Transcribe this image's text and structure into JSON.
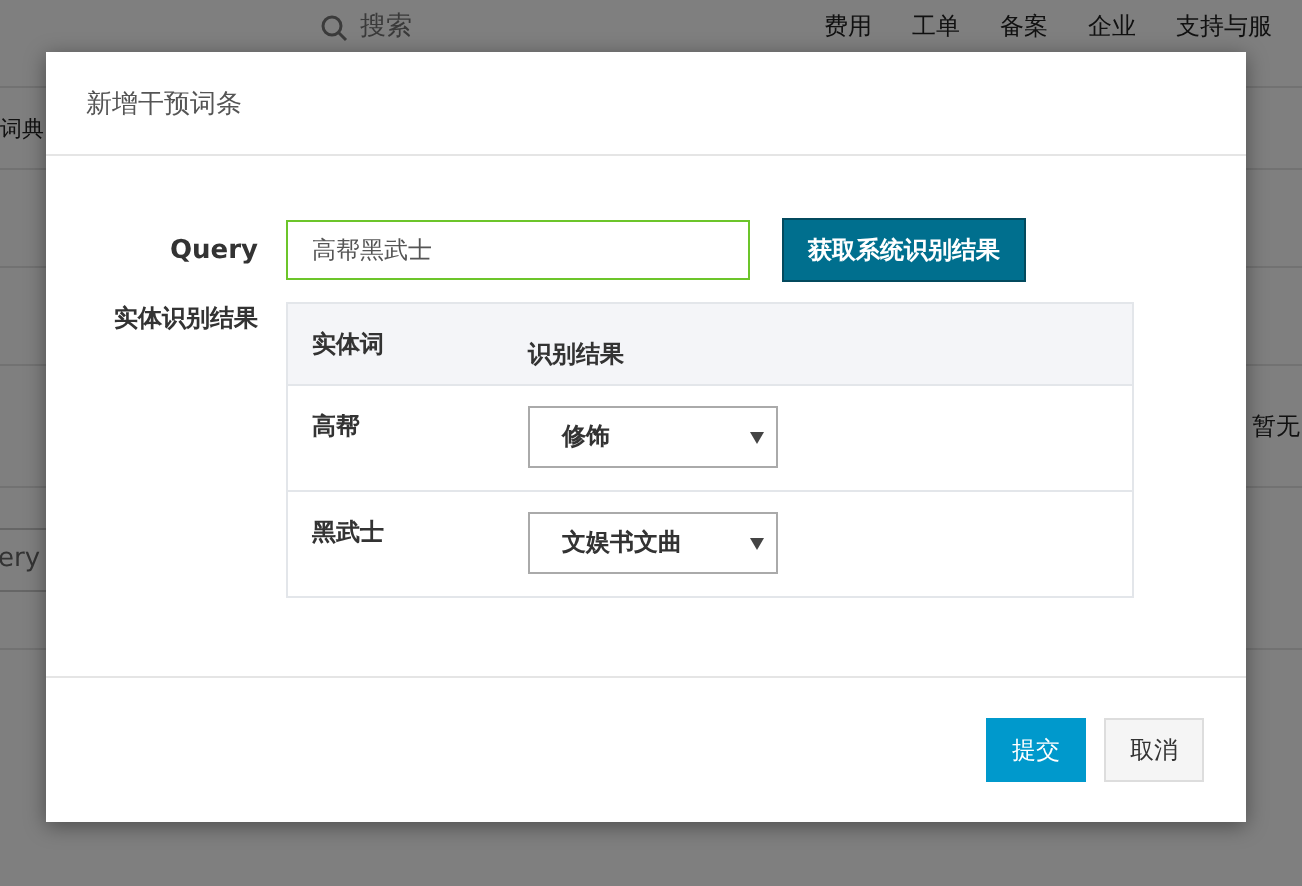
{
  "background": {
    "search": {
      "placeholder": "搜索"
    },
    "nav": [
      "费用",
      "工单",
      "备案",
      "企业",
      "支持与服"
    ],
    "list_label": "词典",
    "empty_text": "暂无",
    "field_value": "ery"
  },
  "dialog": {
    "title": "新增干预词条",
    "query": {
      "label": "Query",
      "value": "高帮黑武士"
    },
    "fetch_button": "获取系统识别结果",
    "entity_label": "实体识别结果",
    "table": {
      "columns": [
        "实体词",
        "识别结果"
      ],
      "rows": [
        {
          "word": "高帮",
          "result": "修饰"
        },
        {
          "word": "黑武士",
          "result": "文娱书文曲"
        }
      ]
    },
    "buttons": {
      "submit": "提交",
      "cancel": "取消"
    }
  }
}
